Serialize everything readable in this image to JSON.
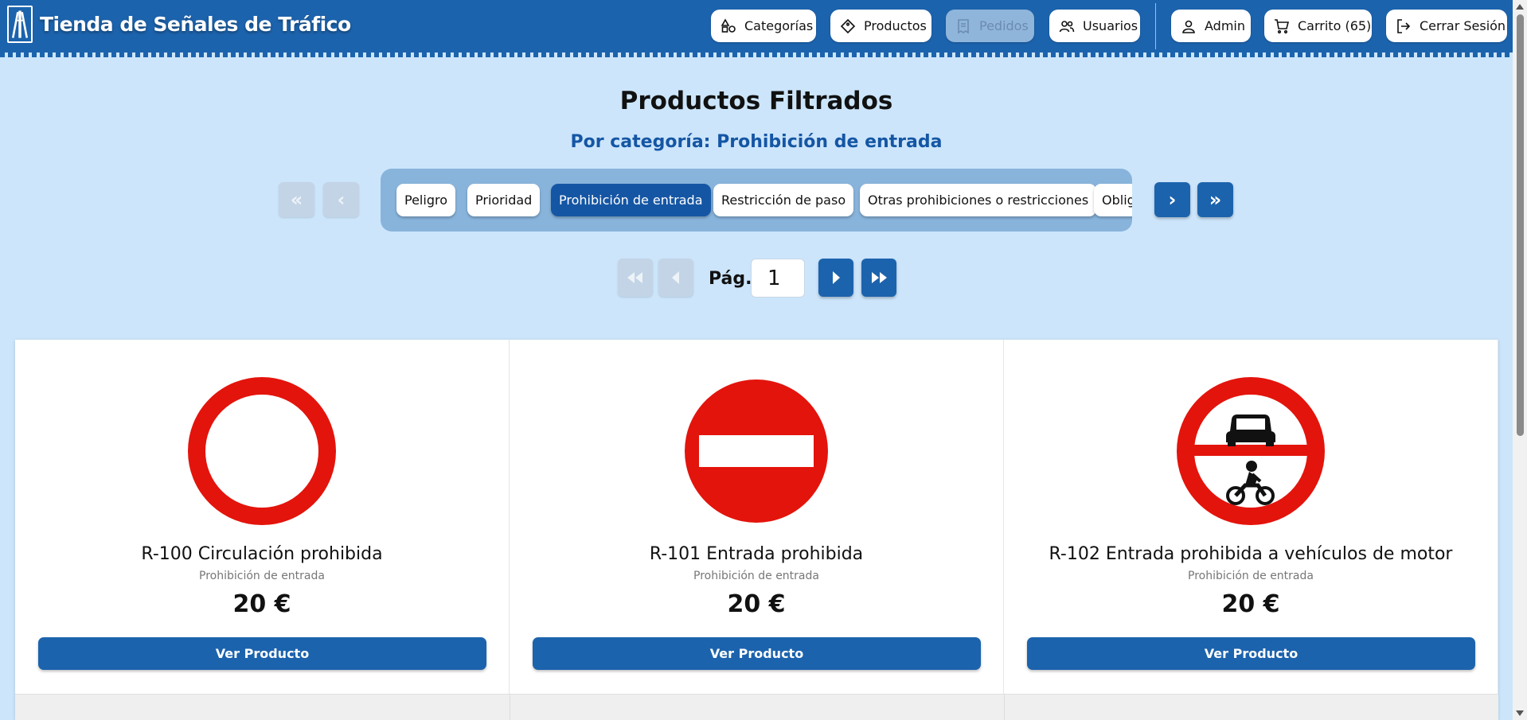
{
  "header": {
    "brand": "Tienda de Señales de Tráfico",
    "nav": [
      {
        "label": "Categorías",
        "icon": "shapes-icon"
      },
      {
        "label": "Productos",
        "icon": "tag-diamond-icon"
      },
      {
        "label": "Pedidos",
        "icon": "receipt-icon",
        "disabled": true
      },
      {
        "label": "Usuarios",
        "icon": "users-icon"
      },
      {
        "label": "Admin",
        "icon": "user-icon"
      },
      {
        "label": "Carrito (65)",
        "icon": "cart-icon"
      },
      {
        "label": "Cerrar Sesión",
        "icon": "logout-icon"
      }
    ]
  },
  "page": {
    "title": "Productos Filtrados",
    "subtitle": "Por categoría: Prohibición de entrada"
  },
  "categories": {
    "items": [
      "Peligro",
      "Prioridad",
      "Prohibición de entrada",
      "Restricción de paso",
      "Otras prohibiciones o restricciones",
      "Obligación"
    ],
    "active": "Prohibición de entrada"
  },
  "pagination": {
    "label": "Pág.",
    "current": "1"
  },
  "products": [
    {
      "title": "R-100 Circulación prohibida",
      "category": "Prohibición de entrada",
      "price": "20 €",
      "button": "Ver Producto",
      "sign": "ring"
    },
    {
      "title": "R-101 Entrada prohibida",
      "category": "Prohibición de entrada",
      "price": "20 €",
      "button": "Ver Producto",
      "sign": "no-entry"
    },
    {
      "title": "R-102 Entrada prohibida a vehículos de motor",
      "category": "Prohibición de entrada",
      "price": "20 €",
      "button": "Ver Producto",
      "sign": "motor"
    }
  ],
  "colors": {
    "primary": "#1c63ad",
    "background": "#cce5fb",
    "sign_red": "#e3140c"
  }
}
